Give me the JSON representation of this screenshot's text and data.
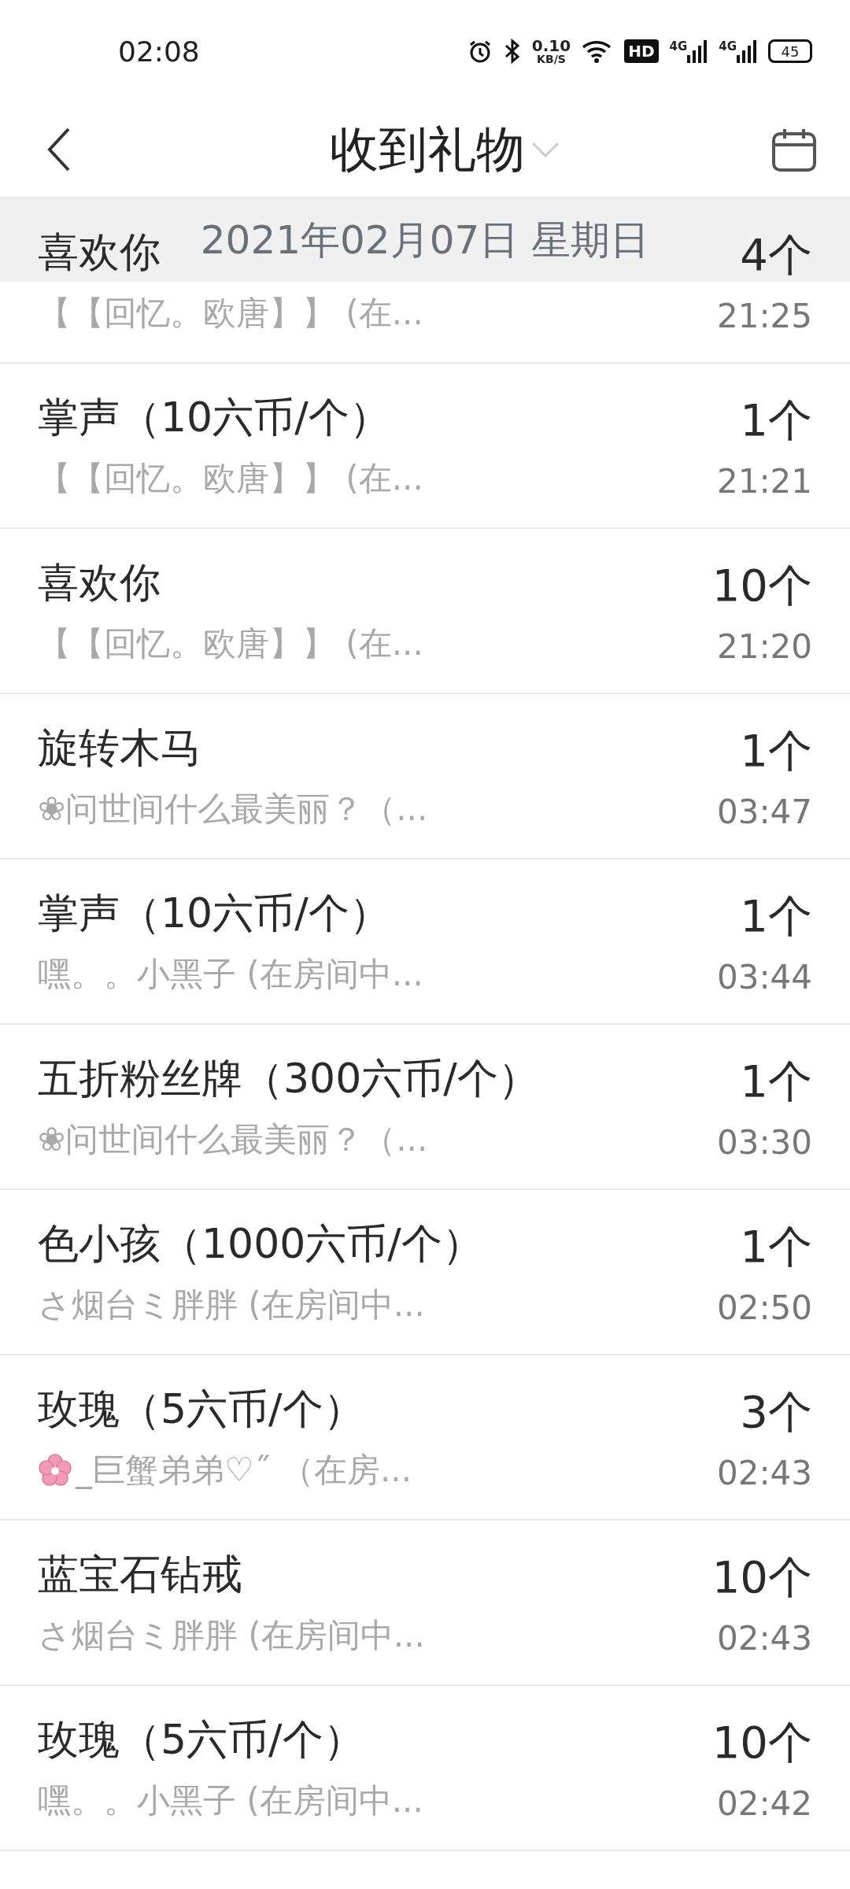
{
  "status_bar": {
    "time": "02:08",
    "speed": "0.10",
    "speed_unit": "KB/S",
    "hd": "HD",
    "network": [
      "4G",
      "4G"
    ],
    "battery": "45"
  },
  "header": {
    "title": "收到礼物"
  },
  "date_banner": "2021年02月07日 星期日",
  "gifts": [
    {
      "name": "喜欢你",
      "sender": "【【回忆。欧唐】】 (在...",
      "count": "4个",
      "time": "21:25",
      "emoji_prefix": false
    },
    {
      "name": "掌声（10六币/个）",
      "sender": "【【回忆。欧唐】】 (在...",
      "count": "1个",
      "time": "21:21",
      "emoji_prefix": false
    },
    {
      "name": "喜欢你",
      "sender": "【【回忆。欧唐】】 (在...",
      "count": "10个",
      "time": "21:20",
      "emoji_prefix": false
    },
    {
      "name": "旋转木马",
      "sender": "❀问世间什么最美丽？（...",
      "count": "1个",
      "time": "03:47",
      "emoji_prefix": false
    },
    {
      "name": "掌声（10六币/个）",
      "sender": "嘿。。小黑子 (在房间中...",
      "count": "1个",
      "time": "03:44",
      "emoji_prefix": false
    },
    {
      "name": "五折粉丝牌（300六币/个）",
      "sender": "❀问世间什么最美丽？（...",
      "count": "1个",
      "time": "03:30",
      "emoji_prefix": false
    },
    {
      "name": "色小孩（1000六币/个）",
      "sender": "さ烟台ミ胖胖 (在房间中...",
      "count": "1个",
      "time": "02:50",
      "emoji_prefix": false
    },
    {
      "name": "玫瑰（5六币/个）",
      "sender": "_巨蟹弟弟♡˝ （在房...",
      "count": "3个",
      "time": "02:43",
      "emoji_prefix": true
    },
    {
      "name": "蓝宝石钻戒",
      "sender": "さ烟台ミ胖胖 (在房间中...",
      "count": "10个",
      "time": "02:43",
      "emoji_prefix": false
    },
    {
      "name": "玫瑰（5六币/个）",
      "sender": "嘿。。小黑子 (在房间中...",
      "count": "10个",
      "time": "02:42",
      "emoji_prefix": false
    }
  ]
}
